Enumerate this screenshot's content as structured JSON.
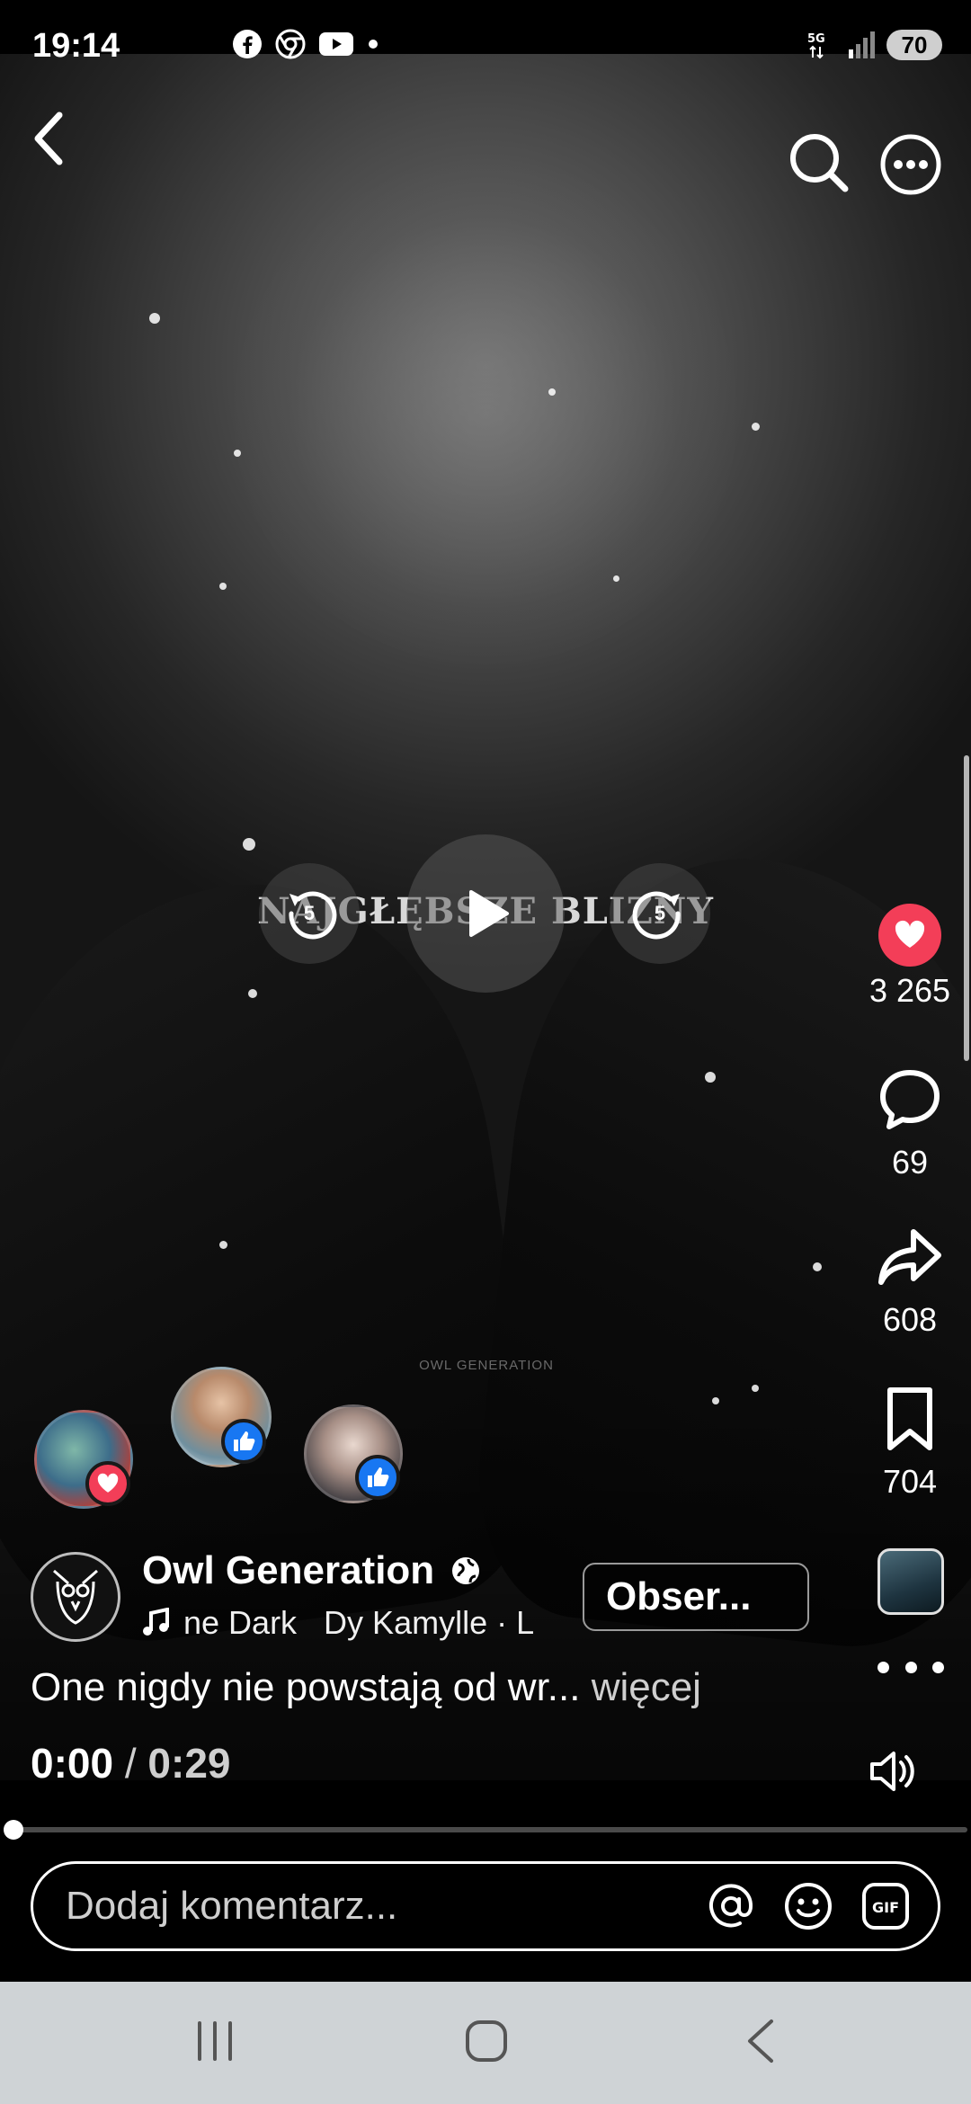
{
  "status_bar": {
    "time": "19:14",
    "network": "5G",
    "battery": "70",
    "app_icons": [
      "facebook-icon",
      "chrome-icon",
      "youtube-icon",
      "dot-icon"
    ]
  },
  "video": {
    "title_overlay": "NAJGŁĘBSZE BLIZNY",
    "watermark": "OWL GENERATION",
    "rewind_seconds": "5",
    "forward_seconds": "5"
  },
  "actions": {
    "like_count": "3 265",
    "comment_count": "69",
    "share_count": "608",
    "save_count": "704"
  },
  "author": {
    "name": "Owl Generation",
    "audio": "ne Dark   Dy Kamylle · L",
    "follow_label": "Obser..."
  },
  "caption": {
    "text": "One nigdy nie powstają od wr...",
    "more": " więcej"
  },
  "playback": {
    "current": "0:00",
    "separator": " / ",
    "total": "0:29",
    "progress_fraction": 0.0
  },
  "comment": {
    "placeholder": "Dodaj komentarz..."
  },
  "colors": {
    "like_red": "#f33e58",
    "facebook_blue": "#1877f2",
    "nav_bar": "#cfd3d6"
  }
}
